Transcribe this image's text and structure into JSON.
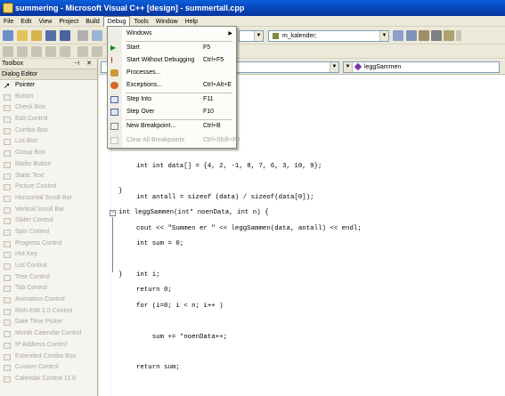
{
  "window": {
    "title": "summering - Microsoft Visual C++ [design] - summertall.cpp"
  },
  "menubar": [
    "File",
    "Edit",
    "View",
    "Project",
    "Build",
    "Debug",
    "Tools",
    "Window",
    "Help"
  ],
  "toolbar": {
    "class_combo": "m_kalender;",
    "member_combo": "leggSammen"
  },
  "toolbox": {
    "title": "Toolbox",
    "title_buttons": "p x",
    "section": "Dialog Editor",
    "items": [
      "Pointer",
      "Button",
      "Check Box",
      "Edit Control",
      "Combo Box",
      "List Box",
      "Group Box",
      "Radio Button",
      "Static Text",
      "Picture Control",
      "Horizontal Scroll Bar",
      "Vertical Scroll Bar",
      "Slider Control",
      "Spin Control",
      "Progress Control",
      "Hot Key",
      "List Control",
      "Tree Control",
      "Tab Control",
      "Animation Control",
      "Rich Edit 2.0 Control",
      "Date Time Picker",
      "Month Calendar Control",
      "IP Address Control",
      "Extended Combo Box",
      "Custom Control",
      "Calendar Control 11.0"
    ]
  },
  "debug_menu": {
    "items": [
      {
        "label": "Windows",
        "key": "",
        "submenu": true,
        "disabled": false
      },
      {
        "label": "Start",
        "key": "F5",
        "disabled": false
      },
      {
        "label": "Start Without Debugging",
        "key": "Ctrl+F5",
        "disabled": false
      },
      {
        "label": "Processes...",
        "key": "",
        "disabled": false
      },
      {
        "label": "Exceptions...",
        "key": "Ctrl+Alt+E",
        "disabled": false
      },
      {
        "label": "Step Into",
        "key": "F11",
        "disabled": false
      },
      {
        "label": "Step Over",
        "key": "F10",
        "disabled": false
      },
      {
        "label": "New Breakpoint...",
        "key": "Ctrl+B",
        "disabled": false
      },
      {
        "label": "Clear All Breakpoints",
        "key": "Ctrl+Shift+F9",
        "disabled": true
      }
    ]
  },
  "editor": {
    "partial_line_1": "int data[] = {4, 2, -1, 8, 7, 6, 3, 10, 9};",
    "partial_line_2": "int antall = sizeof (data) / sizeof(data[0]);",
    "partial_line_3": "cout << \"Summen er \" << leggSammen(data, antall) << endl;",
    "line_return0": "return 0;",
    "line_close_main": "}",
    "fn_signature": "int leggSammen(int* noenData, int n) {",
    "fn_body": [
      "int sum = 0;",
      "int i;",
      "for (i=0; i < n; i++ )",
      "    sum += *noenData++;",
      "return sum;"
    ],
    "fn_close": "}"
  }
}
